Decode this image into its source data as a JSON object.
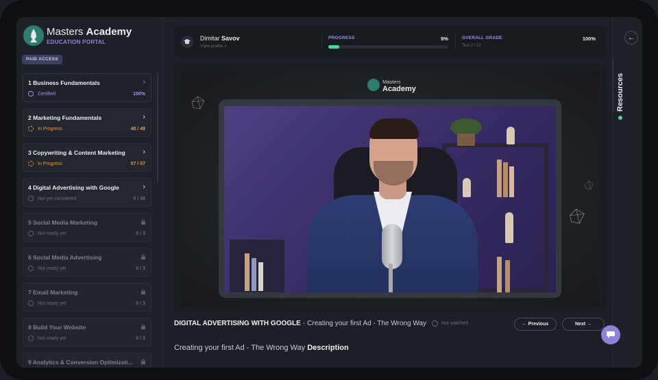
{
  "brand": {
    "name_light": "Masters",
    "name_bold": "Academy",
    "subtitle": "EDUCATION PORTAL",
    "access_badge": "PAID ACCESS"
  },
  "courses": [
    {
      "title": "1 Business Fundamentals",
      "status": "Certified",
      "count": "100%",
      "state": "certified",
      "nav": "chevron-right-icon"
    },
    {
      "title": "2 Marketing Fundamentals",
      "status": "In Progress",
      "count": "48 / 48",
      "state": "progress",
      "nav": "chevron-right-icon"
    },
    {
      "title": "3 Copywriting & Content Marketing",
      "status": "In Progress",
      "count": "57 / 57",
      "state": "progress",
      "nav": "chevron-right-icon"
    },
    {
      "title": "4 Digital Advertising with Google",
      "status": "Not yet completed",
      "count": "0 / 38",
      "state": "none",
      "nav": "chevron-right-icon"
    },
    {
      "title": "5 Social Media Marketing",
      "status": "Not ready yet",
      "count": "0 / 3",
      "state": "locked",
      "nav": "lock-icon"
    },
    {
      "title": "6 Social Media Advertising",
      "status": "Not ready yet",
      "count": "0 / 3",
      "state": "locked",
      "nav": "lock-icon"
    },
    {
      "title": "7 Email Marketing",
      "status": "Not ready yet",
      "count": "0 / 3",
      "state": "locked",
      "nav": "lock-icon"
    },
    {
      "title": "8 Build Your Website",
      "status": "Not ready yet",
      "count": "0 / 3",
      "state": "locked",
      "nav": "lock-icon"
    },
    {
      "title": "9 Analytics & Conversion Optimizati...",
      "status": "",
      "count": "",
      "state": "locked",
      "nav": "lock-icon"
    }
  ],
  "header": {
    "user_first": "Dimitar",
    "user_last": "Savov",
    "view_profile": "View profile >",
    "progress_label": "PROGRESS",
    "progress_value": "9%",
    "progress_fraction": 0.09,
    "grade_label": "OVERALL GRADE",
    "grade_sub": "Test 2 / 22",
    "grade_value": "100%"
  },
  "video": {
    "logo_top": "Masters",
    "logo_bottom": "Academy"
  },
  "lesson": {
    "course": "DIGITAL ADVERTISING WITH GOOGLE",
    "separator": "-",
    "title": "Creating your first Ad - The Wrong Way",
    "watched_status": "Not watched",
    "prev_label": "← Previous",
    "next_label": "Next →",
    "description_prefix": "Creating your first Ad - The Wrong Way",
    "description_label": "Description"
  },
  "rail": {
    "collapse_icon": "←",
    "resources_label": "Resources"
  },
  "colors": {
    "accent": "#8b84d9",
    "success": "#4fd3a6",
    "in_progress": "#e49a4a"
  }
}
